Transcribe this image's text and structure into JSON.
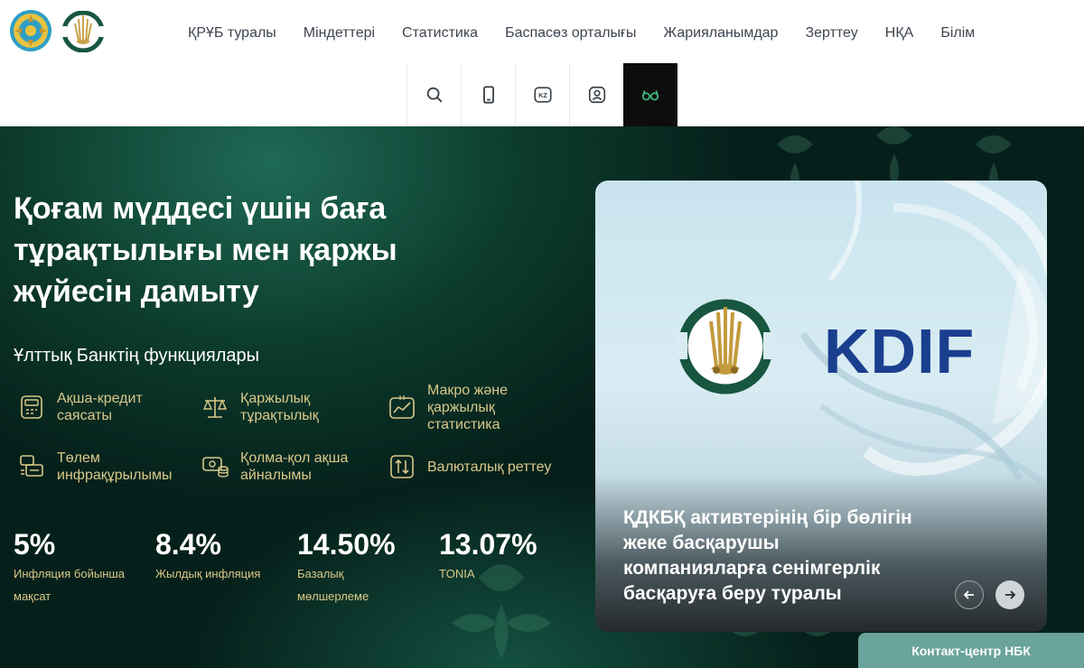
{
  "header": {
    "logo_emblem_icon": "kazakhstan-emblem-icon",
    "logo_nbk_icon": "nbk-logo-icon",
    "nav": [
      {
        "label": "ҚРҰБ туралы"
      },
      {
        "label": "Міндеттері"
      },
      {
        "label": "Статистика"
      },
      {
        "label": "Баспасөз орталығы"
      },
      {
        "label": "Жарияланымдар"
      },
      {
        "label": "Зерттеу"
      },
      {
        "label": "НҚА"
      },
      {
        "label": "Білім"
      }
    ],
    "tools": [
      {
        "icon": "search-icon"
      },
      {
        "icon": "mobile-icon"
      },
      {
        "icon": "language-icon",
        "label": "KZ"
      },
      {
        "icon": "account-icon"
      },
      {
        "icon": "glasses-icon"
      }
    ]
  },
  "hero": {
    "headline": "Қоғам мүддесі үшін баға тұрақтылығы мен қаржы жүйесін дамыту",
    "functions_title": "Ұлттық Банктің функциялары",
    "functions": [
      {
        "label": "Ақша-кредит саясаты",
        "icon": "calculator-icon"
      },
      {
        "label": "Қаржылық тұрақтылық",
        "icon": "scales-icon"
      },
      {
        "label": "Макро және қаржылық статистика",
        "icon": "chart-icon"
      },
      {
        "label": "Төлем инфрақұрылымы",
        "icon": "payment-icon"
      },
      {
        "label": "Қолма-қол ақша айналымы",
        "icon": "cash-icon"
      },
      {
        "label": "Валюталық реттеу",
        "icon": "exchange-icon"
      }
    ],
    "stats": [
      {
        "value": "5%",
        "caption": "Инфляция бойынша мақсат"
      },
      {
        "value": "8.4%",
        "caption": "Жылдық инфляция"
      },
      {
        "value": "14.50%",
        "caption": "Базалық мөлшерлеме"
      },
      {
        "value": "13.07%",
        "caption": "TONIA"
      }
    ]
  },
  "slider": {
    "logo_text": "KDIF",
    "caption": "ҚДКБҚ активтерінің бір бөлігін жеке басқарушы компанияларға сенімгерлік басқаруға беру туралы"
  },
  "contact": {
    "label": "Контакт-центр НБК"
  },
  "colors": {
    "accent_gold": "#d9c98a",
    "hero_green": "#0c3a2c",
    "contact_bg": "#6aa39c",
    "kdif_blue": "#1b3f8f"
  }
}
